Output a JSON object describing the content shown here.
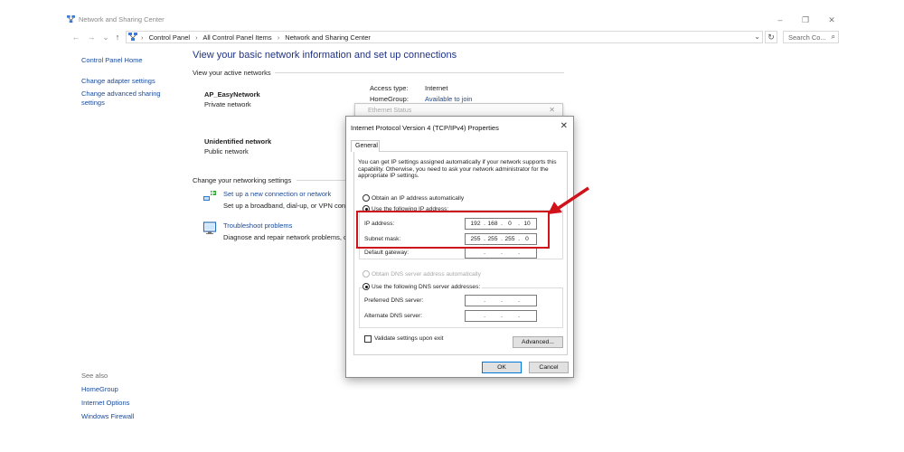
{
  "window": {
    "title": "Network and Sharing Center",
    "min_glyph": "–",
    "max_glyph": "❐",
    "close_glyph": "✕"
  },
  "nav": {
    "back_glyph": "←",
    "forward_glyph": "→",
    "recent_glyph": "⌄",
    "up_glyph": "↑"
  },
  "address": {
    "breadcrumbs": [
      "Control Panel",
      "All Control Panel Items",
      "Network and Sharing Center"
    ],
    "separator": "›",
    "dropdown_glyph": "⌄",
    "refresh_glyph": "↻"
  },
  "search": {
    "placeholder": "Search Co...",
    "icon_glyph": "⌕"
  },
  "sidebar": {
    "home": "Control Panel Home",
    "links": [
      "Change adapter settings",
      "Change advanced sharing settings"
    ],
    "see_also_label": "See also",
    "see_also": [
      "HomeGroup",
      "Internet Options",
      "Windows Firewall"
    ]
  },
  "main": {
    "heading": "View your basic network information and set up connections",
    "active_networks_label": "View your active networks",
    "networks": [
      {
        "name": "AP_EasyNetwork",
        "type": "Private network"
      },
      {
        "name": "Unidentified network",
        "type": "Public network"
      }
    ],
    "access": {
      "access_type_label": "Access type:",
      "access_type_value": "Internet",
      "homegroup_label": "HomeGroup:",
      "homegroup_value": "Available to join"
    },
    "change_settings_label": "Change your networking settings",
    "tasks": [
      {
        "link": "Set up a new connection or network",
        "desc": "Set up a broadband, dial-up, or VPN connection; or set up a router or access point."
      },
      {
        "link": "Troubleshoot problems",
        "desc": "Diagnose and repair network problems, or get troubleshooting information."
      }
    ]
  },
  "ethernet_window": {
    "title": "Ethernet Status",
    "close_glyph": "✕"
  },
  "dialog": {
    "title": "Internet Protocol Version 4 (TCP/IPv4) Properties",
    "close_glyph": "✕",
    "tab": "General",
    "description": "You can get IP settings assigned automatically if your network supports this capability. Otherwise, you need to ask your network administrator for the appropriate IP settings.",
    "obtain_ip_auto": "Obtain an IP address automatically",
    "use_following_ip": "Use the following IP address:",
    "ip_address_label": "IP address:",
    "ip_address": [
      "192",
      "168",
      "0",
      "10"
    ],
    "subnet_mask_label": "Subnet mask:",
    "subnet_mask": [
      "255",
      "255",
      "255",
      "0"
    ],
    "default_gateway_label": "Default gateway:",
    "obtain_dns_auto": "Obtain DNS server address automatically",
    "use_following_dns": "Use the following DNS server addresses:",
    "preferred_dns_label": "Preferred DNS server:",
    "alternate_dns_label": "Alternate DNS server:",
    "validate_label": "Validate settings upon exit",
    "advanced_button": "Advanced...",
    "ok_button": "OK",
    "cancel_button": "Cancel",
    "dot": "."
  },
  "colors": {
    "link": "#1a4a9a",
    "heading": "#1e3287",
    "highlight": "#d0131b"
  }
}
